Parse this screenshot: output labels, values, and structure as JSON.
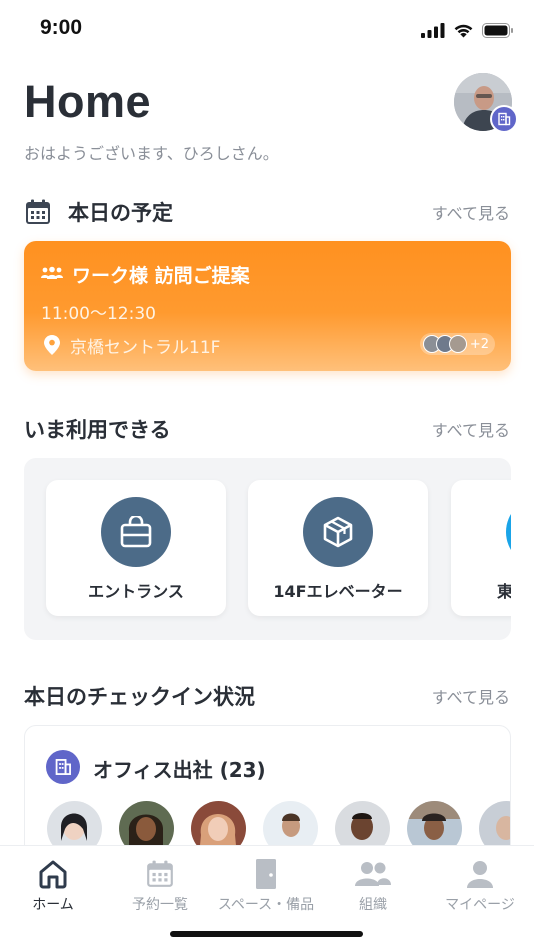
{
  "status_bar": {
    "time": "9:00",
    "icons": [
      "signal-icon",
      "wifi-icon",
      "battery-icon"
    ]
  },
  "header": {
    "title": "Home",
    "greeting": "おはようございます、ひろしさん。",
    "avatar_badge_icon": "building-icon"
  },
  "schedule": {
    "title": "本日の予定",
    "see_all": "すべて見る",
    "event": {
      "title": "ワーク様 訪問ご提案",
      "time": "11:00〜12:30",
      "location": "京橋セントラル11F",
      "extra_attendees": "+2"
    }
  },
  "available": {
    "title": "いま利用できる",
    "see_all": "すべて見る",
    "spaces": [
      {
        "label": "エントランス",
        "icon": "bag-icon"
      },
      {
        "label": "14Fエレベーター",
        "icon": "box-icon"
      },
      {
        "label": "東",
        "icon": "partial-icon"
      }
    ]
  },
  "checkin": {
    "title": "本日のチェックイン状況",
    "see_all": "すべて見る",
    "office_title": "オフィス出社 (23)"
  },
  "tabs": [
    {
      "label": "ホーム",
      "icon": "home-icon",
      "active": true
    },
    {
      "label": "予約一覧",
      "icon": "calendar-icon",
      "active": false
    },
    {
      "label": "スペース・備品",
      "icon": "door-icon",
      "active": false
    },
    {
      "label": "組織",
      "icon": "people-icon",
      "active": false
    },
    {
      "label": "マイページ",
      "icon": "person-icon",
      "active": false
    }
  ],
  "colors": {
    "accent_orange": "#ff9120",
    "space_icon_bg": "#4c6b88",
    "badge_purple": "#6066c9"
  }
}
